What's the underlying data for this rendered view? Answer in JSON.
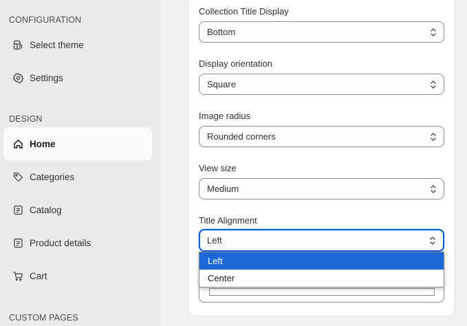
{
  "sidebar": {
    "configuration_title": "CONFIGURATION",
    "design_title": "DESIGN",
    "custom_pages_title": "CUSTOM PAGES",
    "config_items": [
      {
        "label": "Select theme",
        "icon": "theme-icon"
      },
      {
        "label": "Settings",
        "icon": "gear-icon"
      }
    ],
    "design_items": [
      {
        "label": "Home",
        "icon": "home-icon",
        "active": true
      },
      {
        "label": "Categories",
        "icon": "tag-icon"
      },
      {
        "label": "Catalog",
        "icon": "catalog-icon"
      },
      {
        "label": "Product details",
        "icon": "product-details-icon"
      },
      {
        "label": "Cart",
        "icon": "cart-icon"
      }
    ]
  },
  "form": {
    "collection_title_display": {
      "label": "Collection Title Display",
      "value": "Bottom"
    },
    "display_orientation": {
      "label": "Display orientation",
      "value": "Square"
    },
    "image_radius": {
      "label": "Image radius",
      "value": "Rounded corners"
    },
    "view_size": {
      "label": "View size",
      "value": "Medium"
    },
    "title_alignment": {
      "label": "Title Alignment",
      "value": "Left",
      "options": [
        "Left",
        "Center"
      ],
      "highlighted": "Left"
    }
  },
  "colors": {
    "focus_border": "#005bd3",
    "option_highlight": "#1b68d6"
  }
}
